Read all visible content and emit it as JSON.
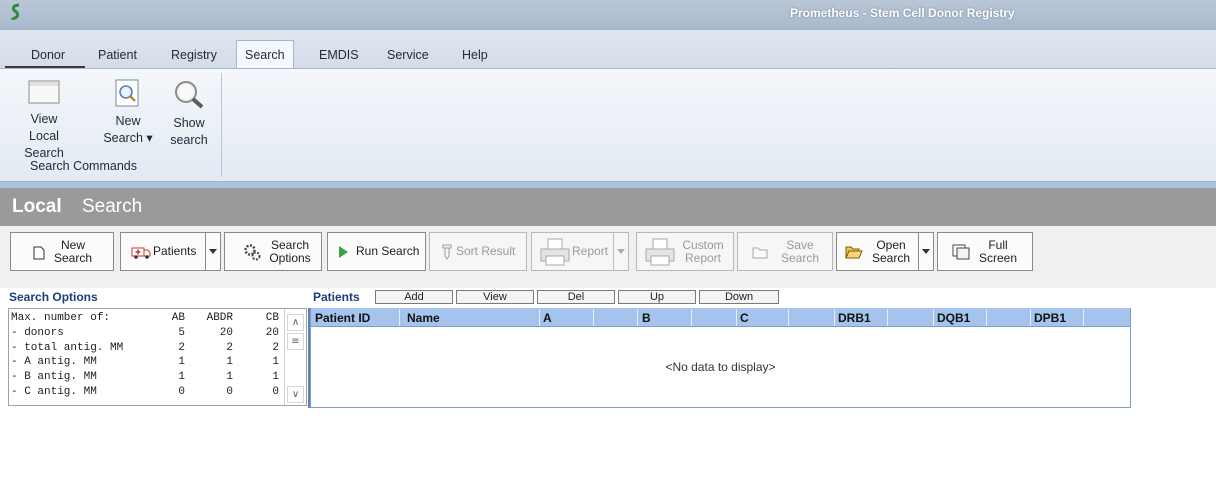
{
  "window": {
    "title": "Prometheus - Stem Cell Donor Registry"
  },
  "ribbon": {
    "tabs": [
      "Donor",
      "Patient",
      "Registry",
      "Search",
      "EMDIS",
      "Service",
      "Help"
    ],
    "active_tab": "Search",
    "buttons": {
      "view_local": [
        "View Local",
        "Search"
      ],
      "new_search": [
        "New",
        "Search ▾"
      ],
      "show_search": [
        "Show",
        "search"
      ]
    },
    "group_label": "Search Commands"
  },
  "header": {
    "bold": "Local",
    "light": "Search"
  },
  "toolbar": {
    "new_search": [
      "New",
      "Search"
    ],
    "patients": "Patients",
    "search_options": [
      "Search",
      "Options"
    ],
    "run_search": "Run Search",
    "sort_result": "Sort Result",
    "report": "Report",
    "custom_report": [
      "Custom",
      "Report"
    ],
    "save_search": [
      "Save",
      "Search"
    ],
    "open_search": [
      "Open",
      "Search"
    ],
    "full_screen": [
      "Full",
      "Screen"
    ]
  },
  "search_options": {
    "title": "Search Options",
    "header": [
      "Max. number of:",
      "AB",
      "ABDR",
      "CB"
    ],
    "rows": [
      [
        "- donors",
        "5",
        "20",
        "20"
      ],
      [
        "- total antig. MM",
        "2",
        "2",
        "2"
      ],
      [
        "- A antig. MM",
        "1",
        "1",
        "1"
      ],
      [
        "- B antig. MM",
        "1",
        "1",
        "1"
      ],
      [
        "- C antig. MM",
        "0",
        "0",
        "0"
      ]
    ]
  },
  "patients": {
    "title": "Patients",
    "buttons": [
      "Add",
      "View",
      "Del",
      "Up",
      "Down"
    ],
    "columns": [
      "Patient ID",
      "Name",
      "A",
      "B",
      "C",
      "DRB1",
      "DQB1",
      "DPB1"
    ],
    "empty_text": "<No data to display>"
  },
  "colors": {
    "header_gray": "#9a9a9a",
    "grid_header": "#a4c4ee",
    "label_blue": "#1e3c7a"
  }
}
